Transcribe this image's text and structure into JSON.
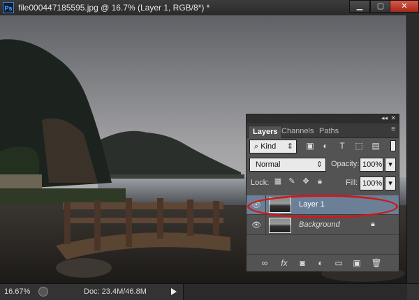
{
  "app": {
    "ps_icon": "Ps",
    "document_title": "file000447185595.jpg @ 16.7% (Layer 1, RGB/8*) *",
    "window_buttons": [
      "minimize",
      "restore",
      "close"
    ]
  },
  "status": {
    "zoom": "16.67%",
    "doc_info": "Doc: 23.4M/46.8M"
  },
  "layers_panel": {
    "tabs": [
      {
        "label": "Layers",
        "active": true
      },
      {
        "label": "Channels",
        "active": false
      },
      {
        "label": "Paths",
        "active": false
      }
    ],
    "filter": {
      "kind_label": "Kind",
      "icons": [
        "image-filter-icon",
        "adjustment-filter-icon",
        "type-filter-icon",
        "shape-filter-icon",
        "smart-object-filter-icon"
      ]
    },
    "blend_mode": "Normal",
    "opacity_label": "Opacity:",
    "opacity_value": "100%",
    "lock_label": "Lock:",
    "fill_label": "Fill:",
    "fill_value": "100%",
    "layers": [
      {
        "name": "Layer 1",
        "selected": true,
        "visible": true,
        "locked": false
      },
      {
        "name": "Background",
        "selected": false,
        "visible": true,
        "locked": true
      }
    ],
    "bottom_icons": [
      "link-layers-icon",
      "fx-icon",
      "add-mask-icon",
      "adjustment-layer-icon",
      "new-group-icon",
      "new-layer-icon",
      "delete-layer-icon"
    ]
  },
  "colors": {
    "ps_blue": "#5aa6ff",
    "selected_layer": "#6b7f97",
    "annotation_red": "#cc1a1a",
    "close_button": "#c0392b"
  }
}
